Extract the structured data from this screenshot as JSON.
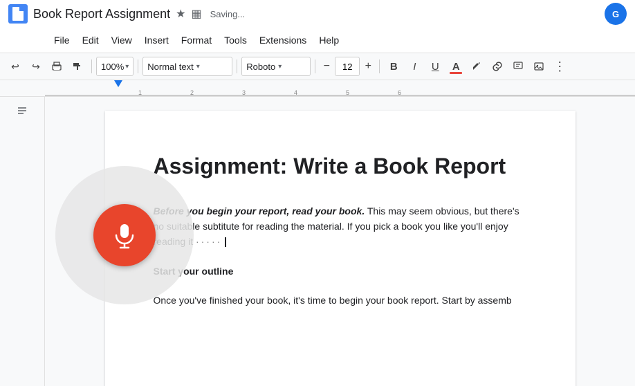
{
  "titleBar": {
    "docIcon": "doc",
    "title": "Book Report Assignment",
    "starLabel": "★",
    "driveLabel": "▦",
    "savingLabel": "Saving...",
    "avatarInitial": "G"
  },
  "menuBar": {
    "items": [
      "File",
      "Edit",
      "View",
      "Insert",
      "Format",
      "Tools",
      "Extensions",
      "Help"
    ]
  },
  "toolbar": {
    "undoLabel": "↩",
    "redoLabel": "↪",
    "printLabel": "🖨",
    "paintLabel": "🎨",
    "zoomValue": "100%",
    "styleLabel": "Normal text",
    "fontLabel": "Roboto",
    "fontSizeValue": "12",
    "boldLabel": "B",
    "italicLabel": "I",
    "underlineLabel": "U",
    "fontColorLabel": "A",
    "highlightLabel": "✏",
    "linkLabel": "🔗",
    "imageLabel": "⊞",
    "moreLabel": "≡"
  },
  "document": {
    "title": "Assignment: Write a Book Report",
    "paragraph1_bold": "Before you begin your report, read your book.",
    "paragraph1_rest": " This may seem obvious, but there's no suitable subtitute for reading the material. If you pick a book you like you'll enjoy reading it",
    "paragraph1_dots": "·····",
    "section2_title": "Start your outline",
    "section2_body": "Once you've finished your book, it's time to begin your book report. Start by assemb"
  },
  "sidebar": {
    "outlineIcon": "≡"
  },
  "voice": {
    "micIcon": "🎤",
    "label": "Voice input"
  },
  "ruler": {
    "numbers": [
      "1",
      "2",
      "3",
      "4",
      "5",
      "6"
    ]
  }
}
